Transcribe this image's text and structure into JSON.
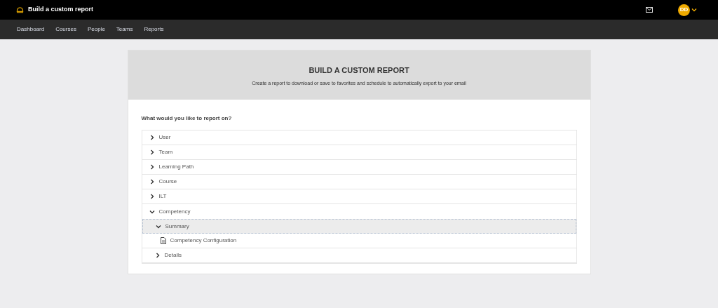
{
  "app_bar": {
    "title": "Build a custom report",
    "avatar": "DD"
  },
  "nav": [
    {
      "label": "Dashboard",
      "selected": false
    },
    {
      "label": "Courses",
      "selected": false
    },
    {
      "label": "People",
      "selected": false
    },
    {
      "label": "Teams",
      "selected": false
    },
    {
      "label": "Reports",
      "selected": false
    }
  ],
  "header": {
    "title": "BUILD A CUSTOM REPORT",
    "subtitle": "Create a report to download or save to favorites and schedule to automatically export to your email"
  },
  "question": "What would you like to report on?",
  "tree": [
    {
      "label": "User",
      "kind": "folder",
      "expanded": false,
      "selected": false
    },
    {
      "label": "Team",
      "kind": "folder",
      "expanded": false,
      "selected": false
    },
    {
      "label": "Learning Path",
      "kind": "folder",
      "expanded": false,
      "selected": false
    },
    {
      "label": "Course",
      "kind": "folder",
      "expanded": false,
      "selected": false
    },
    {
      "label": "ILT",
      "kind": "folder",
      "expanded": false,
      "selected": false
    },
    {
      "label": "Competency",
      "kind": "folder",
      "expanded": true,
      "selected": false,
      "children": [
        {
          "label": "Summary",
          "kind": "folder",
          "expanded": true,
          "selected": true,
          "children": [
            {
              "label": "Competency Configuration",
              "kind": "report",
              "selected": false
            }
          ]
        },
        {
          "label": "Details",
          "kind": "folder",
          "expanded": false,
          "selected": false
        }
      ]
    }
  ]
}
